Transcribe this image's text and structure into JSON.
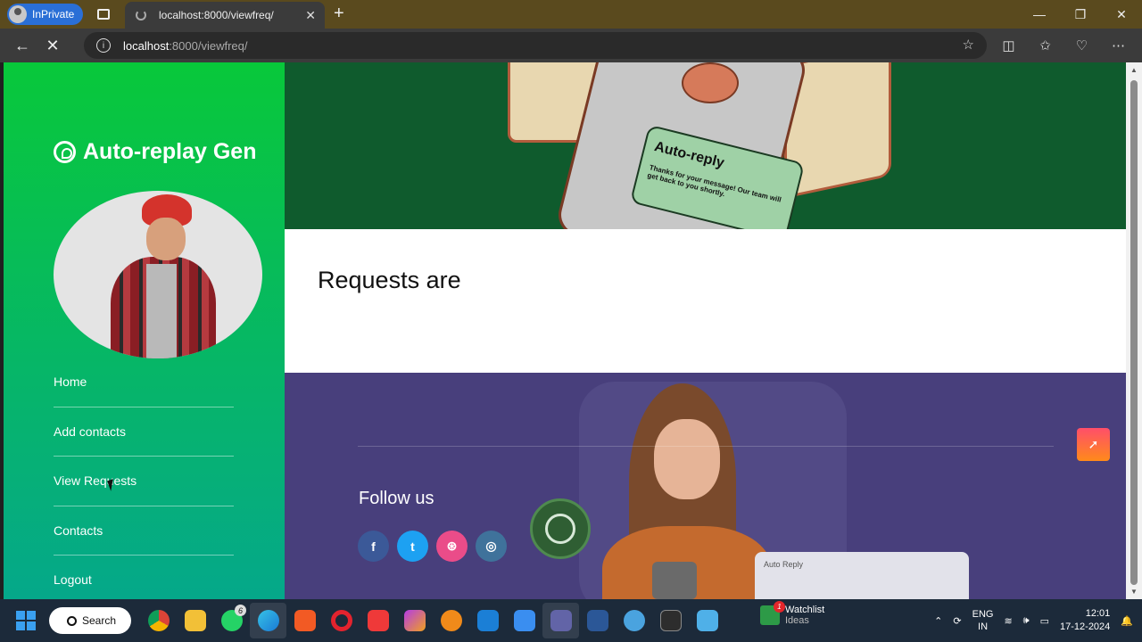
{
  "browser": {
    "inprivate_label": "InPrivate",
    "tab_title": "localhost:8000/viewfreq/",
    "address_host": "localhost",
    "address_path": ":8000/viewfreq/"
  },
  "sidebar": {
    "brand": "Auto-replay Gen",
    "menu": [
      "Home",
      "Add contacts",
      "View Requests",
      "Contacts",
      "Logout"
    ]
  },
  "hero": {
    "card_title": "Auto-reply",
    "card_text": "Thanks for your message! Our team will get back to you shortly."
  },
  "main": {
    "heading": "Requests are"
  },
  "footer": {
    "follow_label": "Follow us",
    "chat_card_title": "Auto Reply",
    "social": [
      {
        "name": "facebook",
        "glyph": "f",
        "color": "#3b5998"
      },
      {
        "name": "twitter",
        "glyph": "t",
        "color": "#1da1f2"
      },
      {
        "name": "dribbble",
        "glyph": "⊛",
        "color": "#ea4c89"
      },
      {
        "name": "instagram",
        "glyph": "◎",
        "color": "#3f729b"
      }
    ]
  },
  "taskbar": {
    "search_label": "Search",
    "whatsapp_badge": "6",
    "watchlist_title": "Watchlist",
    "watchlist_sub": "Ideas",
    "watchlist_badge": "1",
    "lang_1": "ENG",
    "lang_2": "IN",
    "time": "12:01",
    "date": "17-12-2024"
  },
  "colors": {
    "sidebar_top": "#08c83a",
    "sidebar_bottom": "#05a88a",
    "hero_bg": "#0f5b2d",
    "footer_bg": "#483f7c",
    "back_to_top": "#ff6a3a"
  }
}
